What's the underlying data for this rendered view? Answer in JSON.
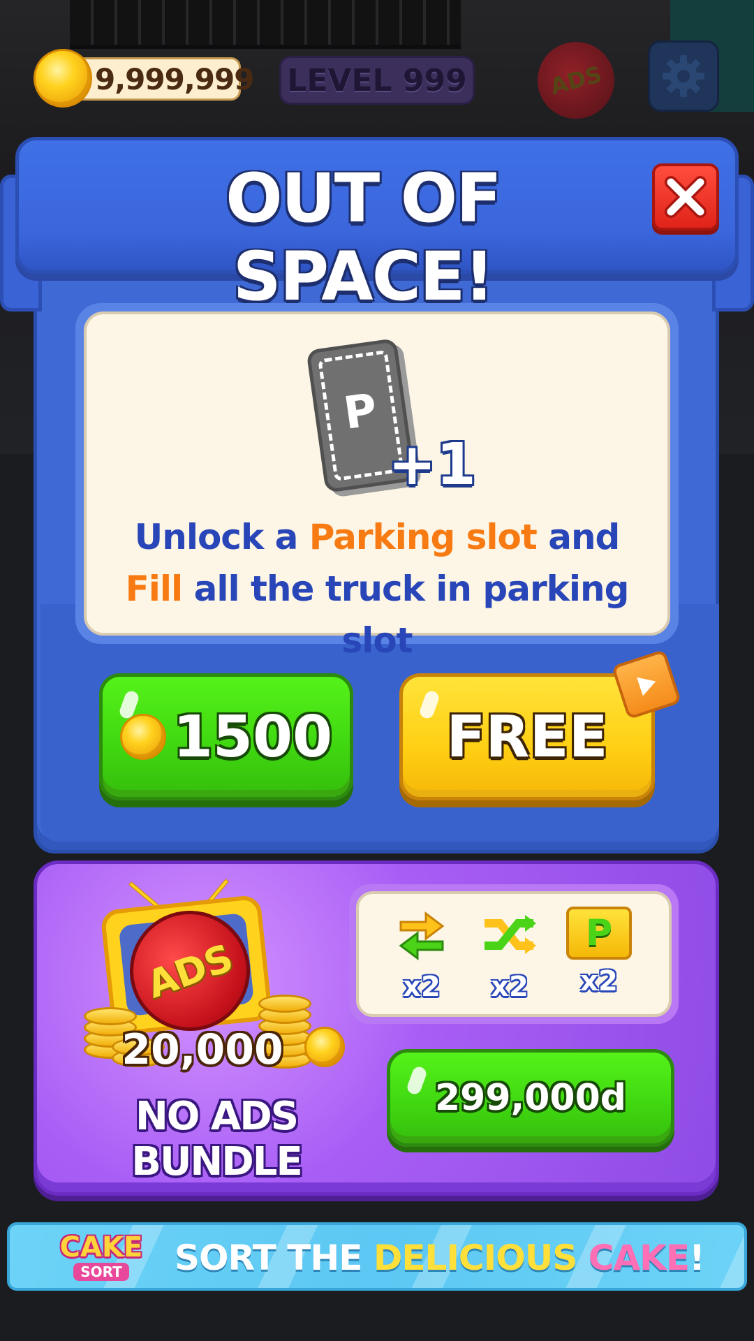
{
  "hud": {
    "coins": "9,999,999",
    "level": "LEVEL 999",
    "ads_label": "ADS",
    "icons": [
      "coin-icon",
      "no-ads-icon",
      "gear-icon"
    ]
  },
  "dialog": {
    "title": "OUT OF SPACE!",
    "close_icon": "close-icon",
    "parking_letter": "P",
    "plus_one": "+1",
    "desc_line1": {
      "a": "Unlock a ",
      "b": "Parking slot",
      "c": " and"
    },
    "desc_line2": {
      "a": "Fill",
      "b": " all the truck in parking slot"
    },
    "buy_button_value": "1500",
    "free_button_label": "FREE",
    "colors": {
      "highlight": "#f77a12",
      "text": "#2846b8",
      "green": "#3fd610",
      "yellow": "#ffcf13"
    }
  },
  "bundle": {
    "ads_label": "ADS",
    "coin_amount": "20,000",
    "name": "NO ADS BUNDLE",
    "items": [
      {
        "icon": "swap-arrows-icon",
        "count": "x2"
      },
      {
        "icon": "shuffle-icon",
        "count": "x2"
      },
      {
        "icon": "parking-icon",
        "count": "x2",
        "letter": "P"
      }
    ],
    "price": "299,000d"
  },
  "banner": {
    "logo_top": "CAKE",
    "logo_bottom": "SORT",
    "text_a": "SORT THE ",
    "text_b": "DELICIOUS",
    "text_c": " CAKE",
    "text_d": "!"
  }
}
